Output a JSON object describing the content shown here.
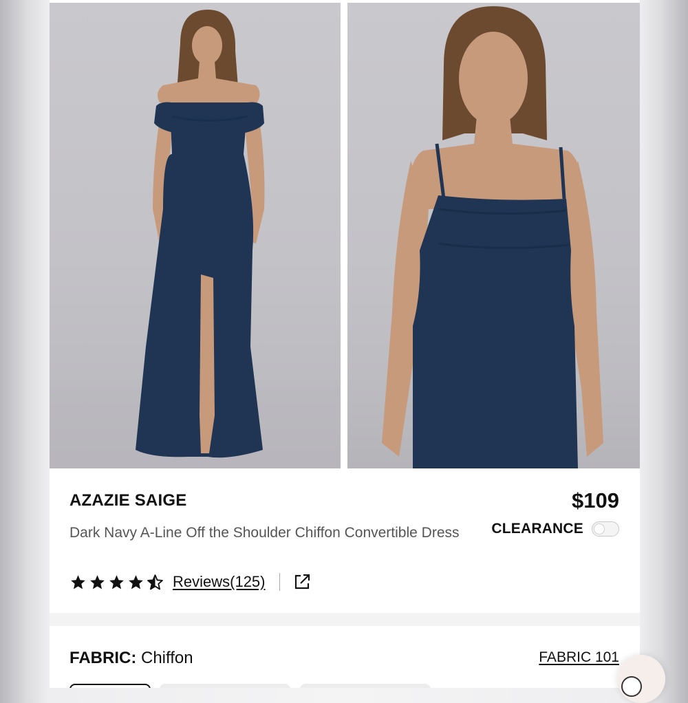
{
  "product": {
    "brand": "AZAZIE SAIGE",
    "price": "$109",
    "name": "Dark Navy A-Line Off the Shoulder Chiffon Convertible Dress",
    "clearance_label": "CLEARANCE",
    "clearance_on": false,
    "rating": 4.5,
    "rating_max": 5,
    "reviews_label": "Reviews(125)"
  },
  "fabric": {
    "label": "FABRIC:",
    "value": "Chiffon",
    "link_label": "FABRIC 101"
  },
  "images": [
    {
      "name": "model-full-length-off-shoulder"
    },
    {
      "name": "model-closeup-spaghetti-strap"
    }
  ],
  "colors": {
    "dress": "#1f3553",
    "background": "#c6c5ca",
    "skin": "#c89a7c",
    "hair": "#6b4a30",
    "text": "#111111",
    "muted_text": "#555555"
  },
  "icons": {
    "star": "star-icon",
    "share": "external-link-icon",
    "toggle": "toggle-switch",
    "chat": "chat-icon"
  }
}
